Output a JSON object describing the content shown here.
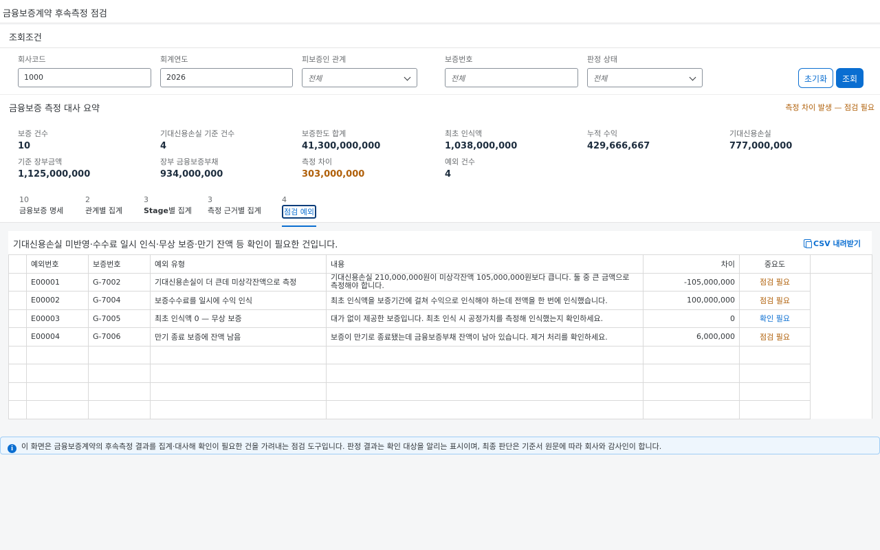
{
  "app": {
    "title": "금융보증계약 후속측정 점검"
  },
  "filters": {
    "panel_title": "조회조건",
    "fields": [
      {
        "label": "회사코드",
        "value": "1000",
        "placeholder": ""
      },
      {
        "label": "회계연도",
        "value": "2026",
        "placeholder": ""
      },
      {
        "label": "피보증인 관계",
        "value": "",
        "placeholder": "전체"
      },
      {
        "label": "보증번호",
        "value": "",
        "placeholder": "전체"
      },
      {
        "label": "판정 상태",
        "value": "",
        "placeholder": "전체"
      }
    ],
    "reset_label": "초기화",
    "search_label": "조회"
  },
  "summary": {
    "title": "금융보증 측정 대사 요약",
    "warning": "측정 차이 발생 — 점검 필요",
    "kpis": [
      {
        "label": "보증 건수",
        "value": "10"
      },
      {
        "label": "기대신용손실 기준 건수",
        "value": "4"
      },
      {
        "label": "보증한도 합계",
        "value": "41,300,000,000"
      },
      {
        "label": "최초 인식액",
        "value": "1,038,000,000"
      },
      {
        "label": "누적 수익",
        "value": "429,666,667"
      },
      {
        "label": "기대신용손실",
        "value": "777,000,000"
      },
      {
        "label": "기준 장부금액",
        "value": "1,125,000,000"
      },
      {
        "label": "장부 금융보증부채",
        "value": "934,000,000"
      },
      {
        "label": "측정 차이",
        "value": "303,000,000"
      },
      {
        "label": "예외 건수",
        "value": "4"
      }
    ]
  },
  "tabs": [
    {
      "count": "10",
      "label": "금융보증 명세"
    },
    {
      "count": "2",
      "label": "관계별 집계"
    },
    {
      "count": "3",
      "label_bold": "Stage",
      "label": "별 집계"
    },
    {
      "count": "3",
      "label": "측정 근거별 집계"
    },
    {
      "count": "4",
      "label": "점검 예외"
    }
  ],
  "exceptions": {
    "description": "기대신용손실 미반영·수수료 일시 인식·무상 보증·만기 잔액 등 확인이 필요한 건입니다.",
    "csv_label": "CSV 내려받기",
    "columns": [
      "예외번호",
      "보증번호",
      "예외 유형",
      "내용",
      "차이",
      "중요도"
    ],
    "rows": [
      {
        "id": "E00001",
        "guarantee": "G-7002",
        "type": "기대신용손실이 더 큰데 미상각잔액으로 측정",
        "content": "기대신용손실 210,000,000원이 미상각잔액 105,000,000원보다 큽니다. 둘 중 큰 금액으로 측정해야 합니다.",
        "diff": "-105,000,000",
        "severity": "점검 필요",
        "sev_color": "#b0600a"
      },
      {
        "id": "E00002",
        "guarantee": "G-7004",
        "type": "보증수수료를 일시에 수익 인식",
        "content": "최초 인식액을 보증기간에 걸쳐 수익으로 인식해야 하는데 전액을 한 번에 인식했습니다.",
        "diff": "100,000,000",
        "severity": "점검 필요",
        "sev_color": "#b0600a"
      },
      {
        "id": "E00003",
        "guarantee": "G-7005",
        "type": "최초 인식액 0 — 무상 보증",
        "content": "대가 없이 제공한 보증입니다. 최초 인식 시 공정가치를 측정해 인식했는지 확인하세요.",
        "diff": "0",
        "severity": "확인 필요",
        "sev_color": "#0a6ed1"
      },
      {
        "id": "E00004",
        "guarantee": "G-7006",
        "type": "만기 종료 보증에 잔액 남음",
        "content": "보증이 만기로 종료됐는데 금융보증부채 잔액이 남아 있습니다. 제거 처리를 확인하세요.",
        "diff": "6,000,000",
        "severity": "점검 필요",
        "sev_color": "#b0600a"
      }
    ]
  },
  "info": {
    "message": "이 화면은 금융보증계약의 후속측정 결과를 집계·대사해 확인이 필요한 건을 가려내는 점검 도구입니다. 판정 결과는 확인 대상을 알리는 표시이며, 최종 판단은 기준서 원문에 따라 회사와 감사인이 합니다."
  }
}
